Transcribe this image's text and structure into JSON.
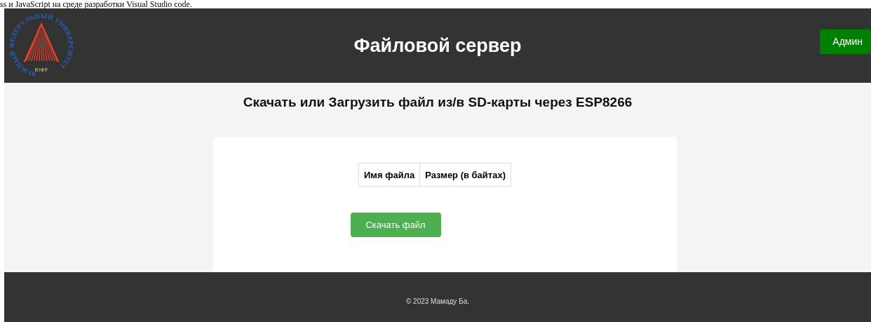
{
  "document_text": "ss и JavaScript  на среде разработки Visual Studio code.",
  "header": {
    "logo": {
      "ring_text": "ЮЖНЫЙ ФЕДЕРАЛЬНЫЙ УНИВЕРСИТЕТ",
      "abbreviation": "ЮФУ"
    },
    "title": "Файловой сервер",
    "admin_button": "Админ"
  },
  "heading": "Скачать или Загрузить файл из/в SD-карты через ESP8266",
  "table": {
    "columns": [
      "Имя файла",
      "Размер (в байтах)"
    ]
  },
  "download_button": "Скачать файл",
  "footer": "© 2023 Мамаду Ба."
}
